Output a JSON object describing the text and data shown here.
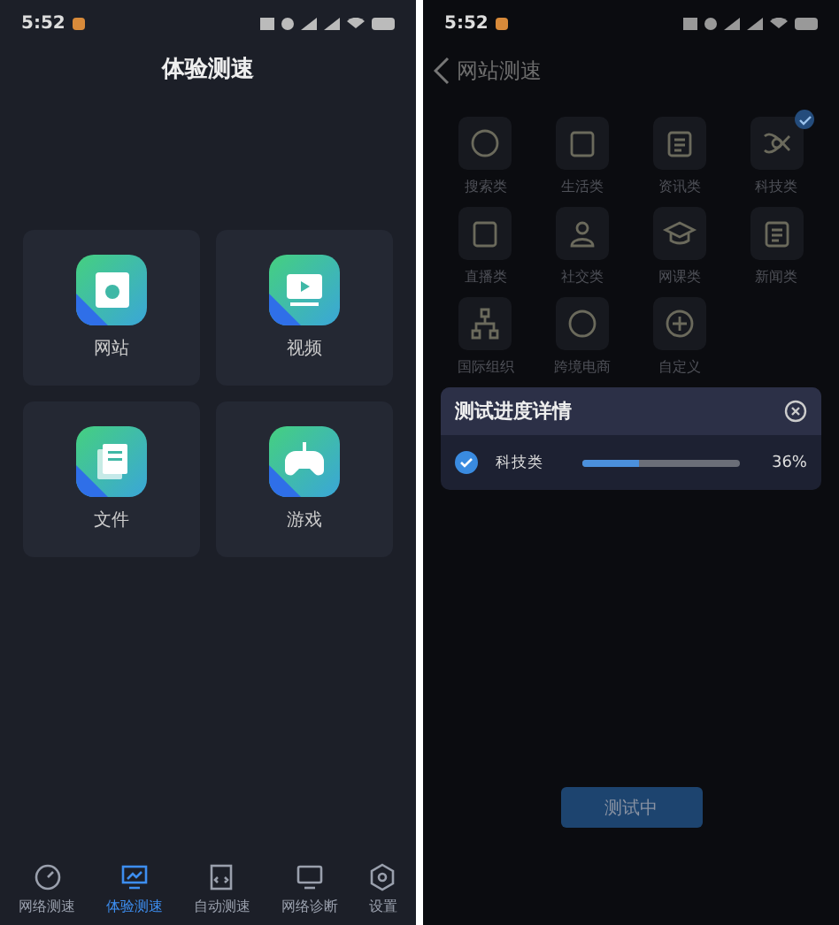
{
  "left_screen": {
    "status_bar": {
      "time": "5:52"
    },
    "title": "体验测速",
    "cards": [
      {
        "label": "网站"
      },
      {
        "label": "视频"
      },
      {
        "label": "文件"
      },
      {
        "label": "游戏"
      }
    ],
    "bottom_nav": [
      {
        "label": "网络测速",
        "selected": false
      },
      {
        "label": "体验测速",
        "selected": true
      },
      {
        "label": "自动测速",
        "selected": false
      },
      {
        "label": "网络诊断",
        "selected": false
      },
      {
        "label": "设置",
        "selected": false
      }
    ]
  },
  "right_screen": {
    "status_bar": {
      "time": "5:52"
    },
    "back": "网站测速",
    "categories": [
      {
        "label": "搜索类",
        "checked": false
      },
      {
        "label": "生活类",
        "checked": false
      },
      {
        "label": "资讯类",
        "checked": false
      },
      {
        "label": "科技类",
        "checked": true
      },
      {
        "label": "直播类",
        "checked": false
      },
      {
        "label": "社交类",
        "checked": false
      },
      {
        "label": "网课类",
        "checked": false
      },
      {
        "label": "新闻类",
        "checked": false
      },
      {
        "label": "国际组织",
        "checked": false
      },
      {
        "label": "跨境电商",
        "checked": false
      },
      {
        "label": "自定义",
        "checked": false
      }
    ],
    "progress_dialog": {
      "title": "测试进度详情",
      "rows": [
        {
          "name": "科技类",
          "checked": true,
          "level": 0.36,
          "reading": "36%"
        }
      ]
    },
    "button": "测试中"
  }
}
